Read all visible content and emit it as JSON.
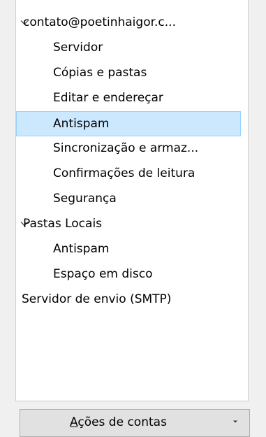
{
  "tree": {
    "account": {
      "label": "contato@poetinhaigor.c...",
      "children": [
        "Servidor",
        "Cópias e pastas",
        "Editar e endereçar",
        "Antispam",
        "Sincronização e armaz...",
        "Confirmações de leitura",
        "Segurança"
      ],
      "selected": "Antispam"
    },
    "local": {
      "label": "Pastas Locais",
      "children": [
        "Antispam",
        "Espaço em disco"
      ]
    },
    "smtp": {
      "label": "Servidor de envio (SMTP)"
    }
  },
  "actions_button": {
    "label": "Ações de contas"
  },
  "colors": {
    "selected_bg": "#cce8ff",
    "selected_border": "#99d1ff",
    "panel_bg": "#ffffff",
    "window_bg": "#f0f0f0"
  },
  "icons": {
    "expand": "chevron-down-icon",
    "scroll_down": "scroll-down-arrow-icon",
    "dropdown": "dropdown-arrow-icon"
  }
}
